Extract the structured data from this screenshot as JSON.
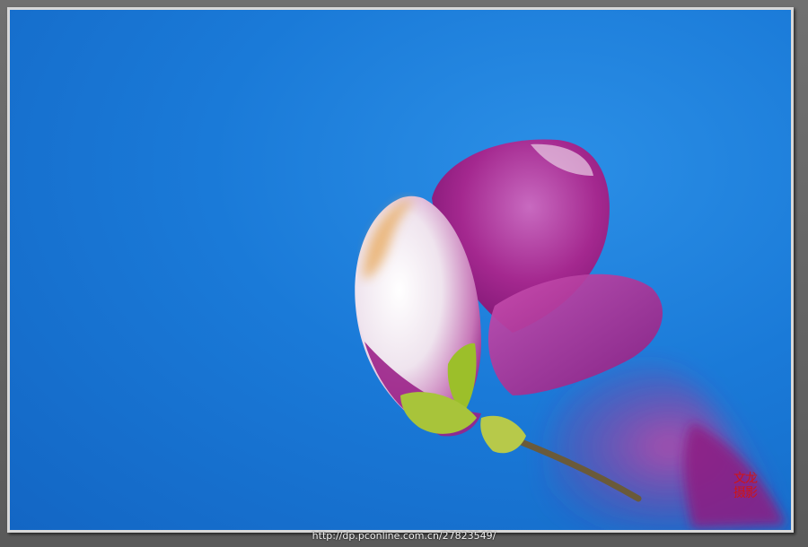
{
  "caption": {
    "url_text": "http://dp.pconline.com.cn/27823549/"
  },
  "signature": {
    "line1": "文龙",
    "line2": "摄影",
    "color": "#d01414"
  },
  "colors": {
    "sky": "#1a7ad8",
    "petal_magenta": "#a0238f",
    "petal_light": "#f0e6ee",
    "leaf_green": "#9cbf2a"
  },
  "scene": {
    "subject": "magnolia-bud"
  }
}
